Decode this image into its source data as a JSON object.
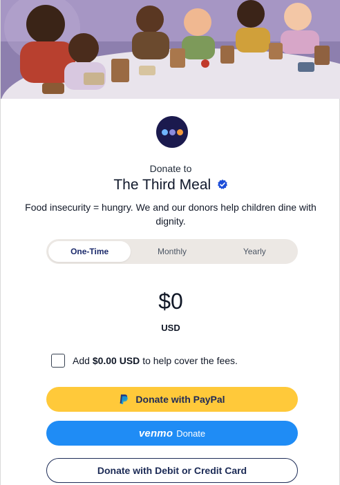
{
  "banner": {
    "alt": "Children sharing lunch at a table"
  },
  "logo": {
    "dot_colors": [
      "#6fb5ff",
      "#8b8bdc",
      "#f49b3a"
    ]
  },
  "header": {
    "donate_to": "Donate to",
    "org_name": "The Third Meal",
    "tagline": "Food insecurity = hungry. We and our donors help children dine with dignity."
  },
  "frequency": {
    "options": [
      "One-Time",
      "Monthly",
      "Yearly"
    ],
    "selected": "One-Time"
  },
  "amount": {
    "value": "$0",
    "currency": "USD"
  },
  "fee": {
    "prefix": "Add",
    "amount": "$0.00 USD",
    "suffix": "to help cover the fees.",
    "checked": false
  },
  "buttons": {
    "paypal": "Donate with PayPal",
    "venmo_brand": "venmo",
    "venmo_label": "Donate",
    "card": "Donate with Debit or Credit Card"
  },
  "colors": {
    "accent_navy": "#1b1a4e",
    "paypal_yellow": "#ffc93a",
    "venmo_blue": "#1f8cf5",
    "verified_blue": "#1d4ed8"
  }
}
